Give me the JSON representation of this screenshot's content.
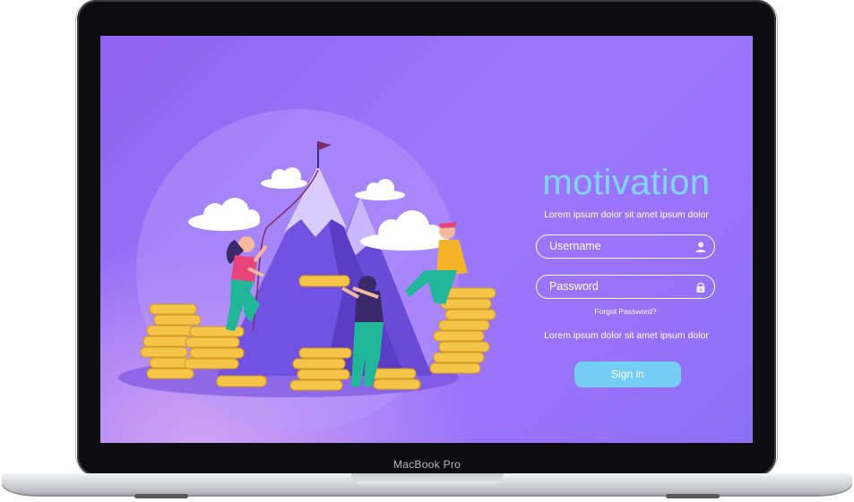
{
  "device": {
    "brand_label": "MacBook Pro"
  },
  "login": {
    "title": "motivation",
    "tagline_top": "Lorem ipsum dolor sit amet ipsum dolor",
    "username_placeholder": "Username",
    "username_icon": "user-icon",
    "password_placeholder": "Password",
    "password_icon": "lock-icon",
    "forgot_password": "Forgot Password?",
    "tagline_bottom": "Lorem ipsum dolor sit amet ipsum dolor",
    "signin_label": "Sign in"
  },
  "colors": {
    "background_start": "#8e63f0",
    "background_end": "#9b78fa",
    "title": "#7fd6f5",
    "signin_button": "#73cdf5"
  }
}
